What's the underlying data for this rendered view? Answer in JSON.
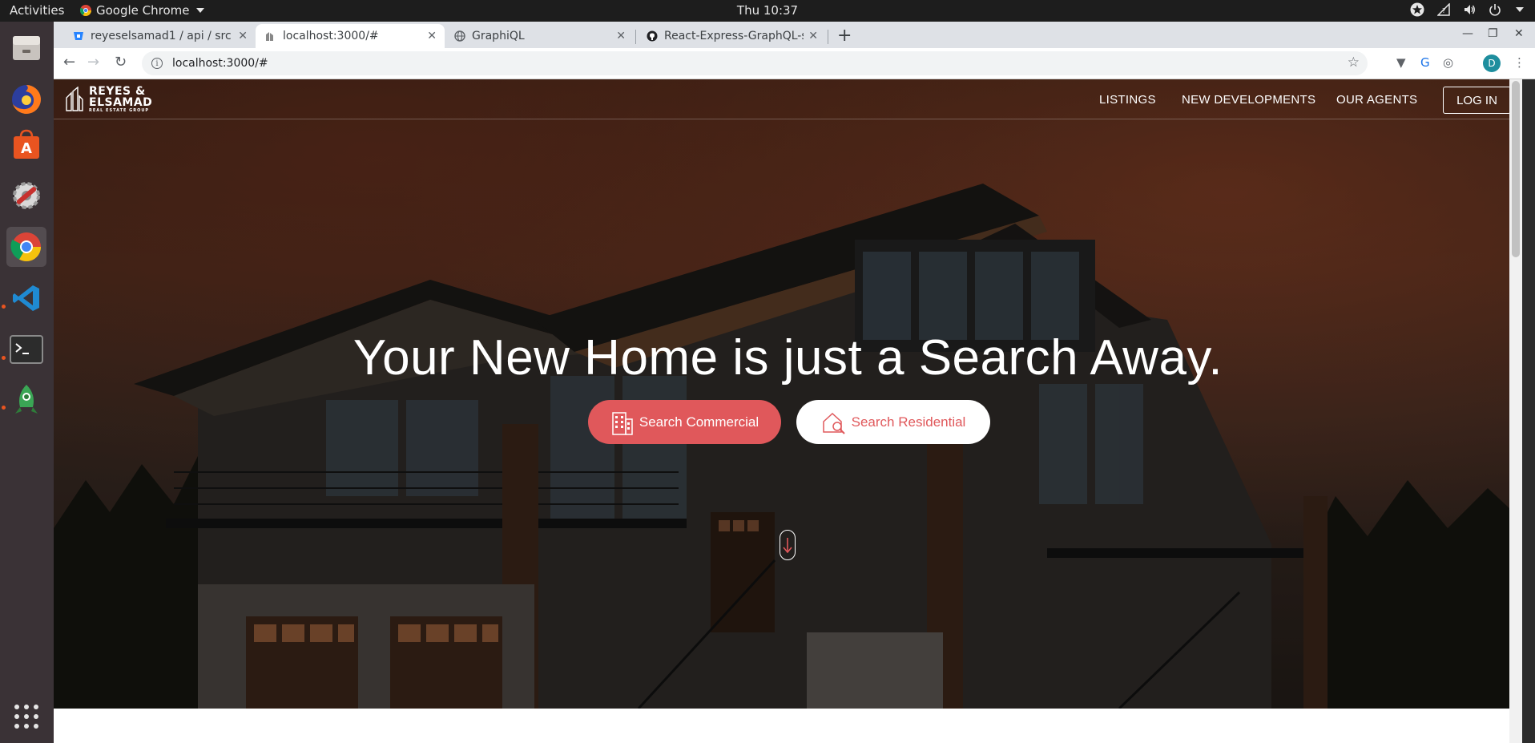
{
  "topbar": {
    "activities": "Activities",
    "app_name": "Google Chrome",
    "clock": "Thu 10:37"
  },
  "chrome": {
    "tabs": [
      {
        "title": "reyeselsamad1 / api / src",
        "icon": "bitbucket-icon"
      },
      {
        "title": "localhost:3000/#",
        "icon": "site-icon"
      },
      {
        "title": "GraphiQL",
        "icon": "globe-icon"
      },
      {
        "title": "React-Express-GraphQL-s",
        "icon": "github-icon"
      }
    ],
    "url": "localhost:3000/#",
    "profile_initial": "D"
  },
  "site": {
    "logo": {
      "line1": "REYES &",
      "line2": "ELSAMAD",
      "tagline": "REAL ESTATE GROUP"
    },
    "nav": {
      "listings": "LISTINGS",
      "new_developments": "NEW DEVELOPMENTS",
      "our_agents": "OUR AGENTS",
      "login": "LOG IN"
    },
    "headline": "Your New Home is just a Search Away.",
    "buttons": {
      "commercial": "Search Commercial",
      "residential": "Search Residential"
    },
    "colors": {
      "accent": "#e0585b"
    }
  }
}
